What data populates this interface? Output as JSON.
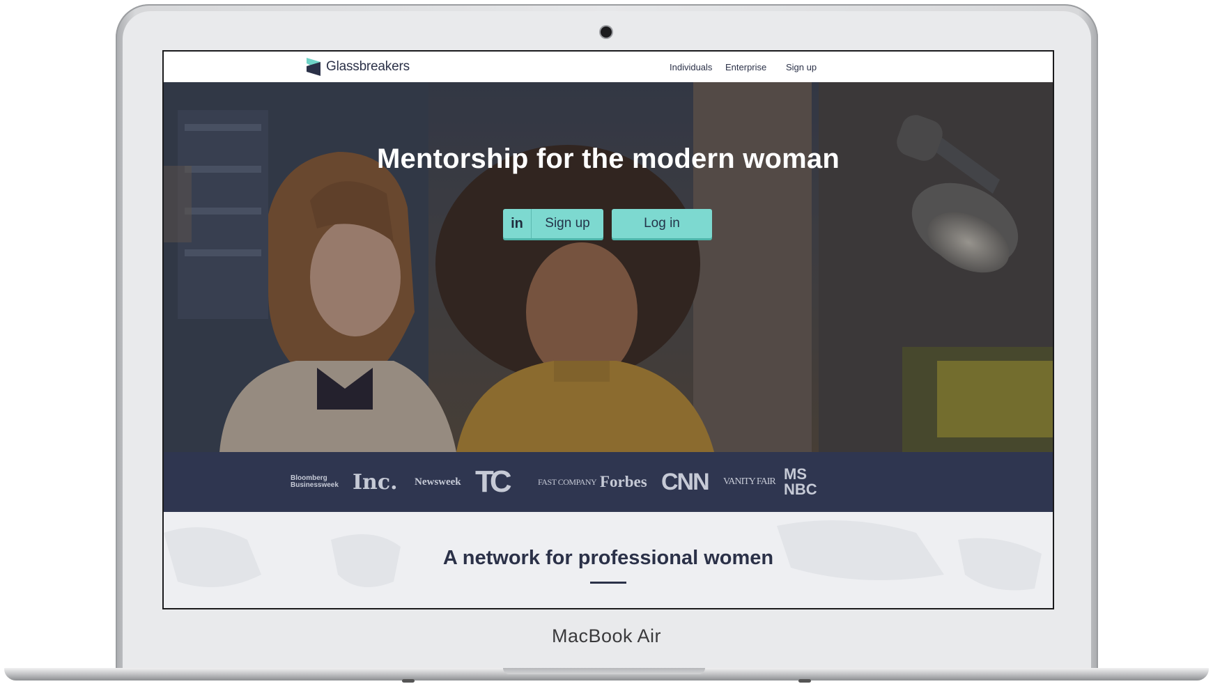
{
  "device": {
    "brand_label": "MacBook Air"
  },
  "site": {
    "logo_text": "Glassbreakers",
    "nav": [
      {
        "label": "Individuals"
      },
      {
        "label": "Enterprise"
      },
      {
        "label": "Sign up"
      }
    ]
  },
  "hero": {
    "headline": "Mentorship for the modern woman",
    "signup_label": "Sign up",
    "linkedin_glyph": "in",
    "login_label": "Log in"
  },
  "press_logos": [
    {
      "name": "Bloomberg Businessweek",
      "line1": "Bloomberg",
      "line2": "Businessweek"
    },
    {
      "name": "Inc.",
      "text": "Inc."
    },
    {
      "name": "Newsweek",
      "text": "Newsweek"
    },
    {
      "name": "TechCrunch",
      "text": "TC"
    },
    {
      "name": "Fast Company",
      "text": "FAST COMPANY"
    },
    {
      "name": "Forbes",
      "text": "Forbes"
    },
    {
      "name": "CNN",
      "text": "CNN"
    },
    {
      "name": "Vanity Fair",
      "text": "VANITY FAIR"
    },
    {
      "name": "MSNBC",
      "line1": "MS",
      "line2": "NBC"
    }
  ],
  "section": {
    "title": "A network for professional women"
  },
  "colors": {
    "accent": "#7dd9d0",
    "navy": "#2f3650",
    "text": "#2b3148"
  }
}
